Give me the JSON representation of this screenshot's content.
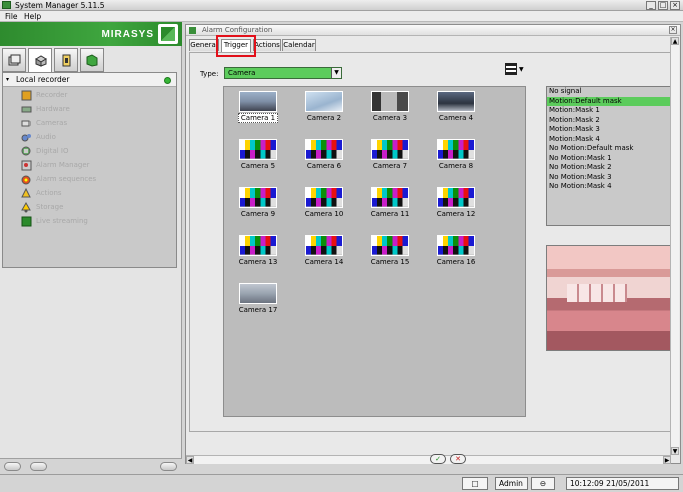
{
  "window": {
    "title": "System Manager 5.11.5",
    "minimize": "_",
    "maximize": "□",
    "close": "×"
  },
  "menu": {
    "items": [
      "File",
      "Help"
    ]
  },
  "brand": {
    "logo_text": "MIRASYS"
  },
  "left_panel": {
    "tabs": [
      "system-icon",
      "cameras-icon",
      "security-icon",
      "network-icon"
    ],
    "recorder_label": "Local recorder",
    "tree_items": [
      "Recorder",
      "Hardware",
      "Cameras",
      "Audio",
      "Digital IO",
      "Alarm Manager",
      "Alarm sequences",
      "Actions",
      "Storage",
      "Live streaming"
    ]
  },
  "dialog": {
    "title": "Alarm Configuration",
    "tabs": [
      "General",
      "Trigger",
      "Actions",
      "Calendar"
    ],
    "active_tab": "Trigger",
    "type_label": "Type:",
    "type_value": "Camera",
    "cameras": [
      "Camera 1",
      "Camera 2",
      "Camera 3",
      "Camera 4",
      "Camera 5",
      "Camera 6",
      "Camera 7",
      "Camera 8",
      "Camera 9",
      "Camera 10",
      "Camera 11",
      "Camera 12",
      "Camera 13",
      "Camera 14",
      "Camera 15",
      "Camera 16",
      "Camera 17"
    ],
    "selected_camera": "Camera 1",
    "mask_options": [
      "No signal",
      "Motion:Default mask",
      "Motion:Mask 1",
      "Motion:Mask 2",
      "Motion:Mask 3",
      "Motion:Mask 4",
      "No Motion:Default mask",
      "No Motion:Mask 1",
      "No Motion:Mask 2",
      "No Motion:Mask 3",
      "No Motion:Mask 4"
    ],
    "selected_mask": "Motion:Default mask",
    "ok_glyph": "✓",
    "cancel_glyph": "✕"
  },
  "status": {
    "user": "Admin",
    "datetime": "10:12:09 21/05/2011"
  },
  "colors": {
    "accent_green": "#5ccc5c",
    "highlight_red": "#e2101a",
    "brand_green": "#2e8b2e"
  }
}
